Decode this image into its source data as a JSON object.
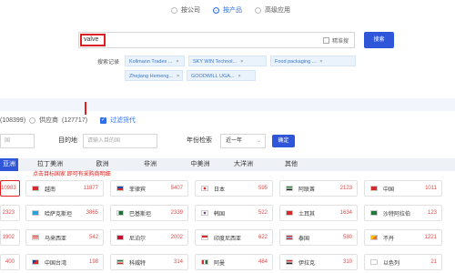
{
  "search_mode": {
    "options": [
      {
        "label": "按公司",
        "checked": false
      },
      {
        "label": "按产品",
        "checked": true
      },
      {
        "label": "高级应用",
        "checked": false
      }
    ]
  },
  "search": {
    "value": "valve",
    "precise_label": "精准搜",
    "button_label": "搜索"
  },
  "history": {
    "label": "搜索记录",
    "items": [
      "Kollmann Trades ...",
      "SKY WIN Technol...",
      "Food packaging ...",
      "Zhejiang Hemeng...",
      "GOODWILL UGA..."
    ]
  },
  "counts": {
    "buyer_count": "(108399)",
    "supplier_label": "供应商",
    "supplier_count": "(127717)",
    "filter_label": "过滤货代"
  },
  "filters": {
    "origin_placeholder": "国",
    "dest_label": "目的地",
    "dest_placeholder": "请输入目的国",
    "year_label": "年份检索",
    "year_value": "近一年",
    "confirm_label": "确定"
  },
  "tabs": [
    {
      "label": "亚洲",
      "active": true
    },
    {
      "label": "拉丁美洲",
      "active": false
    },
    {
      "label": "欧洲",
      "active": false
    },
    {
      "label": "非洲",
      "active": false
    },
    {
      "label": "中美洲",
      "active": false
    },
    {
      "label": "大洋洲",
      "active": false
    },
    {
      "label": "其他",
      "active": false
    }
  ],
  "hint": "点击目标国家 即可有采购商明细",
  "countries": [
    {
      "name": "",
      "count": "10983"
    },
    {
      "name": "越南",
      "count": "11877"
    },
    {
      "name": "菲律宾",
      "count": "5407"
    },
    {
      "name": "日本",
      "count": "595"
    },
    {
      "name": "阿联酋",
      "count": "2123"
    },
    {
      "name": "中国",
      "count": "1011"
    },
    {
      "name": "",
      "count": "2323"
    },
    {
      "name": "哈萨克斯坦",
      "count": "3865"
    },
    {
      "name": "巴基斯坦",
      "count": "2339"
    },
    {
      "name": "韩国",
      "count": "522"
    },
    {
      "name": "土耳其",
      "count": "1634"
    },
    {
      "name": "沙特阿拉伯",
      "count": "123"
    },
    {
      "name": "",
      "count": "1902"
    },
    {
      "name": "马来西亚",
      "count": "542"
    },
    {
      "name": "尼泊尔",
      "count": "2002"
    },
    {
      "name": "印度尼西亚",
      "count": "622"
    },
    {
      "name": "泰国",
      "count": "580"
    },
    {
      "name": "不丹",
      "count": "1221"
    },
    {
      "name": "",
      "count": "400"
    },
    {
      "name": "中国台湾",
      "count": "198"
    },
    {
      "name": "科威特",
      "count": "314"
    },
    {
      "name": "阿曼",
      "count": "484"
    },
    {
      "name": "伊拉克",
      "count": "310"
    },
    {
      "name": "以色列",
      "count": "21"
    }
  ],
  "colors": {
    "accent": "#2f56d8",
    "highlight_red": "#e02020"
  }
}
